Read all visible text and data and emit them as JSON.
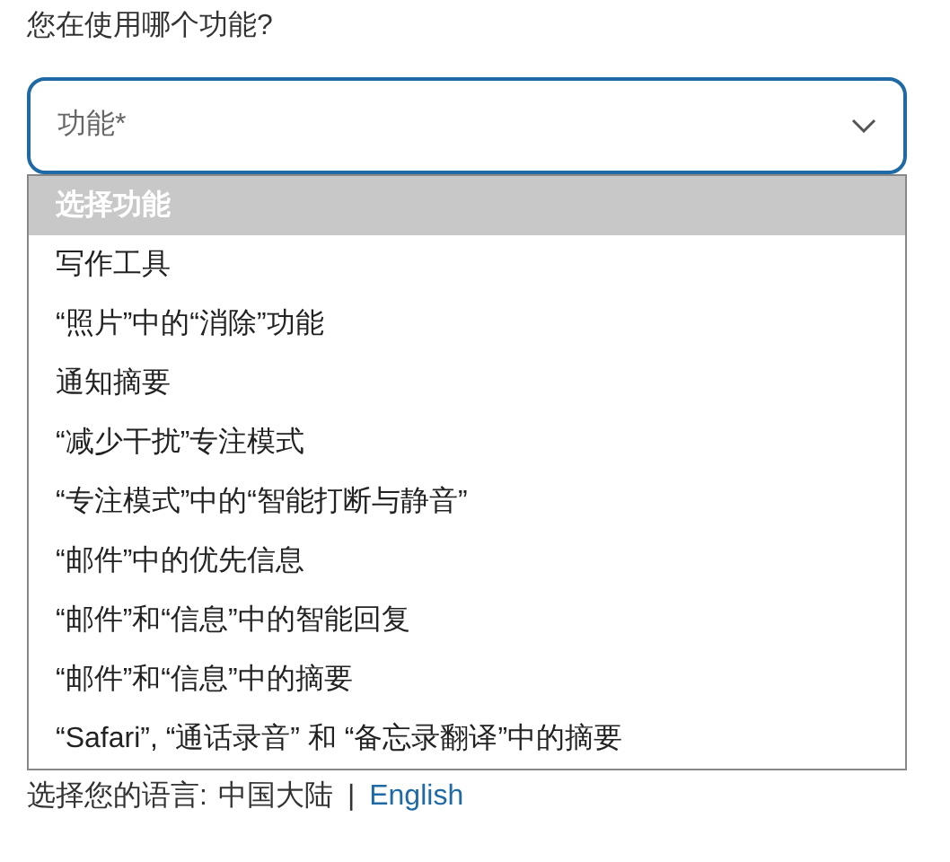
{
  "question": "您在使用哪个功能?",
  "select": {
    "placeholder": "功能*",
    "expanded": true
  },
  "options": [
    {
      "label": "选择功能",
      "selected": true
    },
    {
      "label": "写作工具",
      "selected": false
    },
    {
      "label": "“照片”中的“消除”功能",
      "selected": false
    },
    {
      "label": "通知摘要",
      "selected": false
    },
    {
      "label": "“减少干扰”专注模式",
      "selected": false
    },
    {
      "label": "“专注模式”中的“智能打断与静音”",
      "selected": false
    },
    {
      "label": "“邮件”中的优先信息",
      "selected": false
    },
    {
      "label": "“邮件”和“信息”中的智能回复",
      "selected": false
    },
    {
      "label": "“邮件”和“信息”中的摘要",
      "selected": false
    },
    {
      "label": "“Safari”, “通话录音” 和 “备忘录翻译”中的摘要",
      "selected": false
    }
  ],
  "footer": {
    "label": "选择您的语言:",
    "region": "中国大陆",
    "separator": "|",
    "link": "English"
  }
}
